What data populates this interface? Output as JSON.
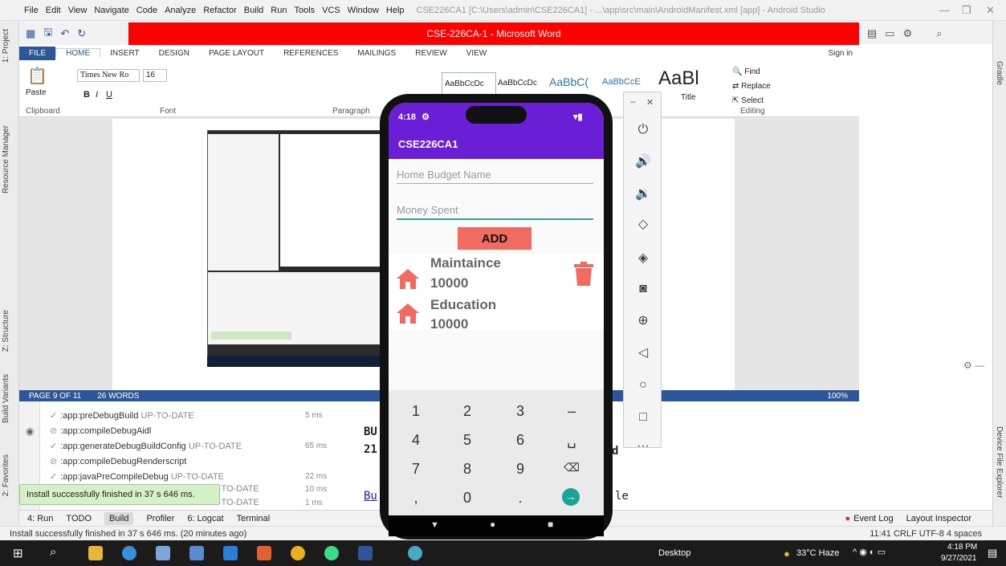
{
  "android_studio": {
    "menu": [
      "File",
      "Edit",
      "View",
      "Navigate",
      "Code",
      "Analyze",
      "Refactor",
      "Build",
      "Run",
      "Tools",
      "VCS",
      "Window",
      "Help"
    ],
    "window_title": "CSE226CA1 [C:\\Users\\admin\\CSE226CA1] - ...\\app\\src\\main\\AndroidManifest.xml [app] - Android Studio",
    "left_tabs": [
      "1: Project",
      "Resource Manager",
      "Z: Structure",
      "Build Variants",
      "2: Favorites"
    ],
    "right_tabs": [
      "Gradle",
      "Device File Explorer"
    ],
    "build_tasks": [
      {
        "icon": "check",
        "name": ":app:preDebugBuild",
        "status": "UP-TO-DATE",
        "time": "5 ms"
      },
      {
        "icon": "skip",
        "name": ":app:compileDebugAidl",
        "status": "",
        "time": ""
      },
      {
        "icon": "check",
        "name": ":app:generateDebugBuildConfig",
        "status": "UP-TO-DATE",
        "time": "65 ms"
      },
      {
        "icon": "skip",
        "name": ":app:compileDebugRenderscript",
        "status": "",
        "time": ""
      },
      {
        "icon": "check",
        "name": ":app:javaPreCompileDebug",
        "status": "UP-TO-DATE",
        "time": "22 ms"
      },
      {
        "icon": "",
        "name": "s",
        "status": "UP-TO-DATE",
        "time": "10 ms"
      },
      {
        "icon": "",
        "name": "s",
        "status": "UP-TO-DATE",
        "time": "1 ms"
      }
    ],
    "build_output": {
      "line1": "BU",
      "line2": "21",
      "line3": "d",
      "line4": "Bu",
      "line5": "le"
    },
    "balloon": "Install successfully finished in 37 s 646 ms.",
    "bottom_tabs": [
      "4: Run",
      "TODO",
      "Build",
      "Profiler",
      "6: Logcat",
      "Terminal"
    ],
    "bottom_right": [
      "Event Log",
      "Layout Inspector"
    ],
    "status_text": "Install successfully finished in 37 s 646 ms. (20 minutes ago)",
    "status_right": "11:41  CRLF  UTF-8  4 spaces"
  },
  "word": {
    "title": "CSE-226CA-1 - Microsoft Word",
    "sign_in": "Sign in",
    "tabs": [
      "FILE",
      "HOME",
      "INSERT",
      "DESIGN",
      "PAGE LAYOUT",
      "REFERENCES",
      "MAILINGS",
      "REVIEW",
      "VIEW"
    ],
    "font_name": "Times New Ro",
    "font_size": "16",
    "groups": [
      "Clipboard",
      "Font",
      "Paragraph",
      "Editing"
    ],
    "styles": [
      "AaBbCcDc",
      "AaBbCcDc",
      "AaBbC(",
      "AaBbCcE",
      "AaBl"
    ],
    "style_title": "Title",
    "editing": [
      "Find",
      "Replace",
      "Select"
    ],
    "paste": "Paste",
    "page_info": "PAGE 9 OF 11",
    "words": "26 WORDS",
    "zoom": "100%"
  },
  "phone": {
    "time": "4:18",
    "app_title": "CSE226CA1",
    "field1_placeholder": "Home Budget Name",
    "field2_placeholder": "Money Spent",
    "add_label": "ADD",
    "items": [
      {
        "name": "Maintaince",
        "amount": "10000"
      },
      {
        "name": "Education",
        "amount": "10000"
      }
    ],
    "keys": [
      "1",
      "2",
      "3",
      "–",
      "4",
      "5",
      "6",
      "␣",
      "7",
      "8",
      "9",
      "⌫",
      ",",
      "0",
      ".",
      "→"
    ]
  },
  "taskbar": {
    "desktop": "Desktop",
    "weather": "33°C Haze",
    "time": "4:18 PM",
    "date": "9/27/2021"
  },
  "colors": {
    "app_purple": "#6a1fd6",
    "add_button": "#f06b60",
    "home_icon": "#f06b60",
    "word_red": "#ff0000",
    "word_blue": "#2b579a"
  }
}
